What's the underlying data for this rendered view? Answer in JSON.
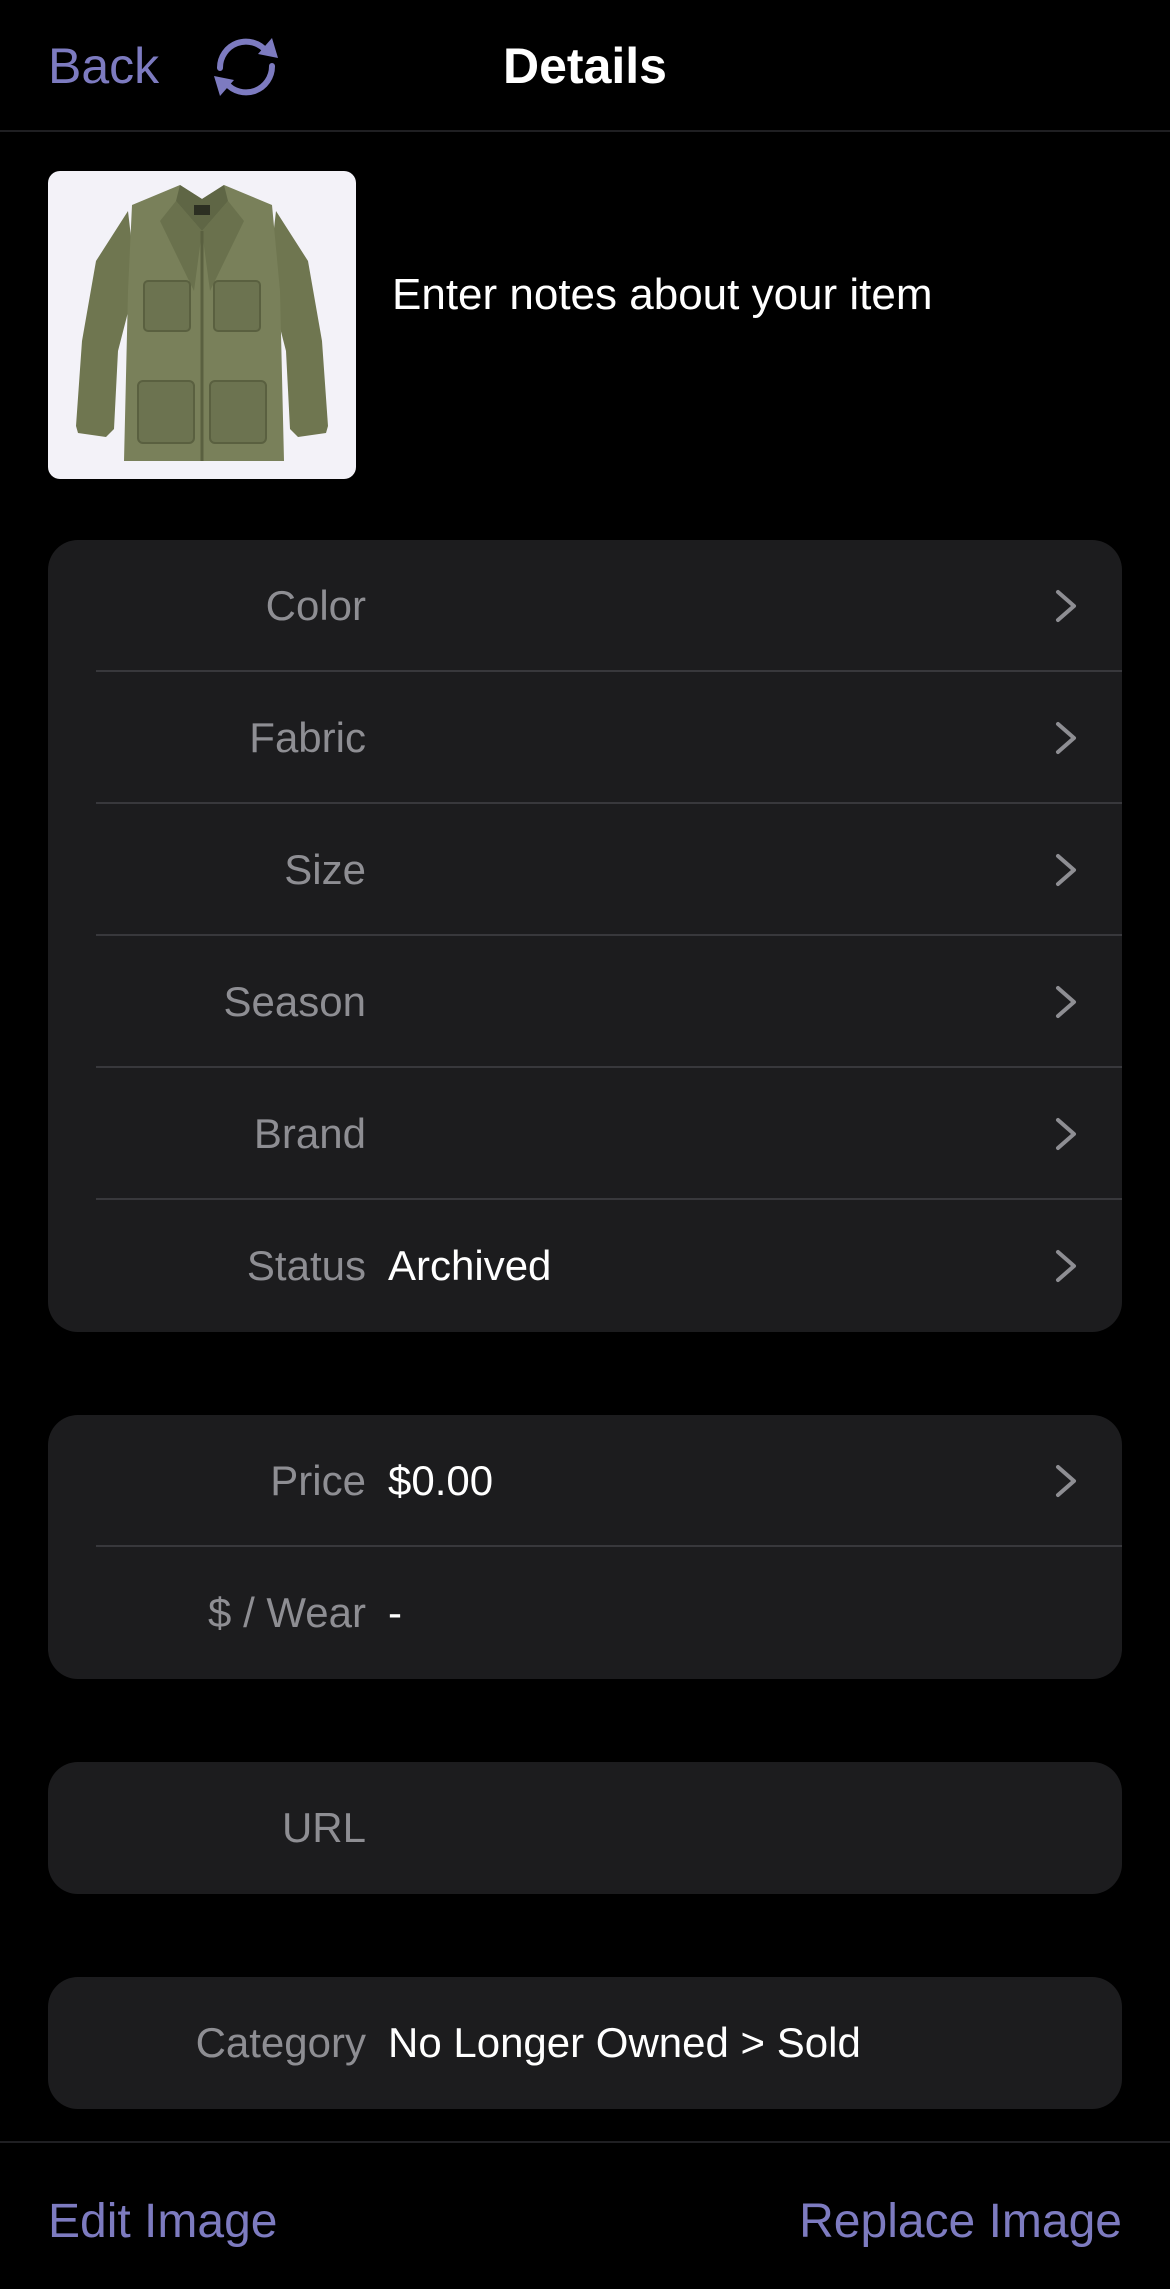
{
  "nav": {
    "back_label": "Back",
    "sync_icon": "sync-arrows-icon",
    "title": "Details"
  },
  "item": {
    "image_desc": "olive-green-utility-jacket",
    "notes_placeholder": "Enter notes about your item"
  },
  "attributes": [
    {
      "label": "Color",
      "value": ""
    },
    {
      "label": "Fabric",
      "value": ""
    },
    {
      "label": "Size",
      "value": ""
    },
    {
      "label": "Season",
      "value": ""
    },
    {
      "label": "Brand",
      "value": ""
    },
    {
      "label": "Status",
      "value": "Archived"
    }
  ],
  "pricing": {
    "price_label": "Price",
    "price_value": "$0.00",
    "per_wear_label": "$ / Wear",
    "per_wear_value": "-"
  },
  "url": {
    "label": "URL",
    "value": ""
  },
  "category": {
    "label": "Category",
    "value": "No Longer Owned > Sold"
  },
  "bottom": {
    "edit_image_label": "Edit Image",
    "replace_image_label": "Replace Image"
  },
  "colors": {
    "accent": "#7d7bc0",
    "background": "#000000",
    "card": "#1c1c1e",
    "label_gray": "#8e8e93"
  }
}
